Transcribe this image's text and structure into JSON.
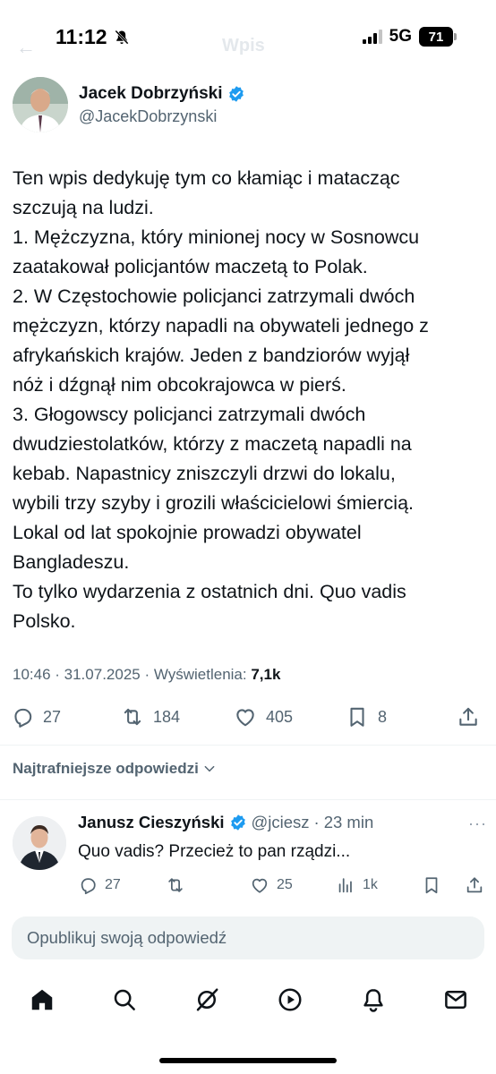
{
  "status_bar": {
    "time": "11:12",
    "network": "5G",
    "battery": "71",
    "ghost_back": "←",
    "ghost_title": "Wpis"
  },
  "post": {
    "author_name": "Jacek Dobrzyński",
    "author_handle": "@JacekDobrzynski",
    "text": "Ten wpis dedykuję tym co kłamiąc i matacząc\nszczują na ludzi.\n1. Mężczyzna, który minionej nocy w Sosnowcu\nzaatakował policjantów maczetą to Polak.\n2. W Częstochowie policjanci zatrzymali dwóch\nmężczyzn, którzy napadli na obywateli jednego z\nafrykańskich krajów. Jeden z bandziorów wyjął\nnóż i dźgnął nim obcokrajowca w pierś.\n3. Głogowscy policjanci zatrzymali dwóch\ndwudziestolatków, którzy z maczetą napadli na\nkebab. Napastnicy zniszczyli drzwi do lokalu,\nwybili trzy szyby i grozili właścicielowi śmiercią.\nLokal od lat spokojnie prowadzi obywatel\nBangladeszu.\nTo tylko wydarzenia z ostatnich dni. Quo vadis\nPolsko.",
    "meta_prefix": "10:46 · 31.07.2025 · Wyświetlenia: ",
    "views": "7,1k",
    "stats": {
      "replies": "27",
      "reposts": "184",
      "likes": "405",
      "bookmarks": "8"
    }
  },
  "replies_sort": {
    "label": "Najtrafniejsze odpowiedzi"
  },
  "reply": {
    "name": "Janusz Cieszyński",
    "handle": "@jciesz",
    "separator": "·",
    "time": "23 min",
    "more": "···",
    "text": "Quo vadis? Przecież to pan rządzi...",
    "stats": {
      "replies": "27",
      "likes": "25",
      "views": "1k"
    }
  },
  "compose": {
    "placeholder": "Opublikuj swoją odpowiedź"
  },
  "colors": {
    "verified": "#1d9bf0",
    "secondary_text": "#536471",
    "primary_text": "#0f1419",
    "compose_bg": "#eff3f4"
  },
  "icons": [
    "bell-slash-icon",
    "verified-badge-icon",
    "reply-icon",
    "repost-icon",
    "like-icon",
    "bookmark-icon",
    "share-icon",
    "chevron-down-icon",
    "views-icon",
    "home-icon",
    "search-icon",
    "grok-icon",
    "video-icon",
    "notifications-icon",
    "messages-icon"
  ]
}
